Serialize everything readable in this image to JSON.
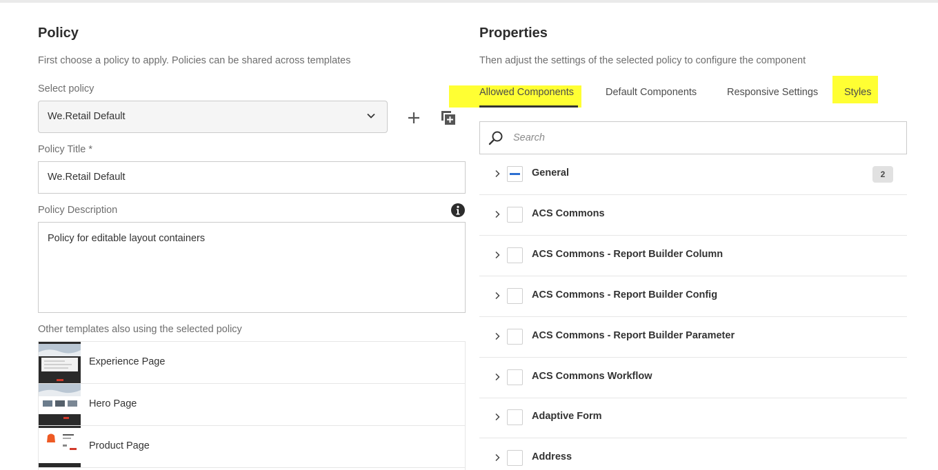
{
  "policy": {
    "heading": "Policy",
    "description": "First choose a policy to apply. Policies can be shared across templates",
    "select_label": "Select policy",
    "select_value": "We.Retail Default",
    "title_label": "Policy Title *",
    "title_value": "We.Retail Default",
    "description_label": "Policy Description",
    "description_value": "Policy for editable layout containers",
    "other_templates_label": "Other templates also using the selected policy",
    "templates": [
      {
        "name": "Experience Page"
      },
      {
        "name": "Hero Page"
      },
      {
        "name": "Product Page"
      }
    ]
  },
  "properties": {
    "heading": "Properties",
    "description": "Then adjust the settings of the selected policy to configure the component",
    "tabs": [
      {
        "label": "Allowed Components",
        "selected": true,
        "highlighted": true
      },
      {
        "label": "Default Components",
        "selected": false,
        "highlighted": false
      },
      {
        "label": "Responsive Settings",
        "selected": false,
        "highlighted": false
      },
      {
        "label": "Styles",
        "selected": false,
        "highlighted": true
      }
    ],
    "search_placeholder": "Search",
    "groups": [
      {
        "name": "General",
        "state": "indeterminate",
        "count": "2"
      },
      {
        "name": "ACS Commons",
        "state": "unchecked"
      },
      {
        "name": "ACS Commons - Report Builder Column",
        "state": "unchecked"
      },
      {
        "name": "ACS Commons - Report Builder Config",
        "state": "unchecked"
      },
      {
        "name": "ACS Commons - Report Builder Parameter",
        "state": "unchecked"
      },
      {
        "name": "ACS Commons Workflow",
        "state": "unchecked"
      },
      {
        "name": "Adaptive Form",
        "state": "unchecked"
      },
      {
        "name": "Address",
        "state": "unchecked"
      }
    ]
  },
  "colors": {
    "highlight": "#ffff33",
    "checkbox_indeterminate": "#2d6fd1",
    "tab_underline": "#323232"
  },
  "icons": {
    "select_chevron": "chevron-down-icon",
    "add": "plus-icon",
    "duplicate": "duplicate-icon",
    "info": "info-icon",
    "search": "search-icon",
    "tree_chevron": "chevron-right-icon"
  }
}
